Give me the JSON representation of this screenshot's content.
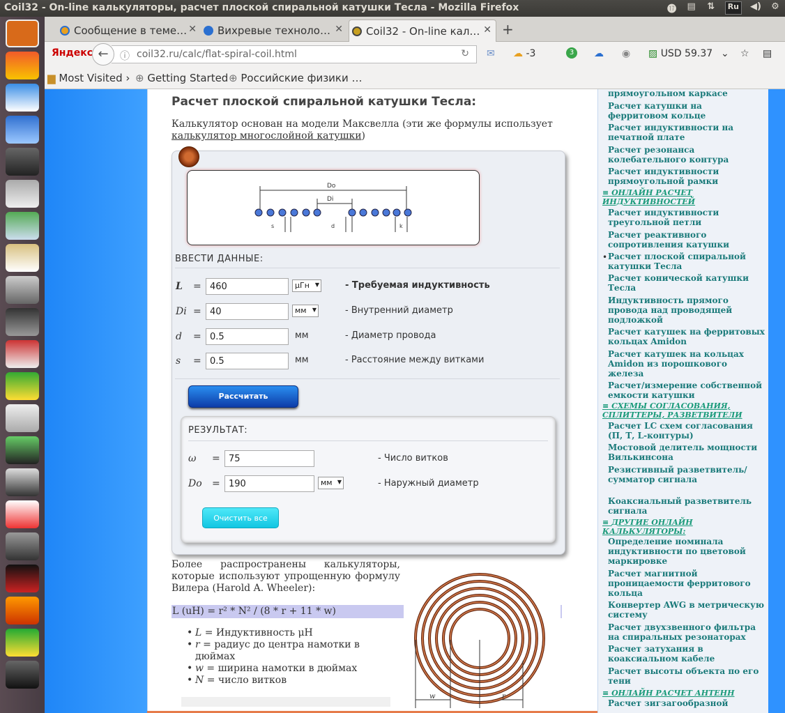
{
  "window": {
    "title": "Coil32 - On-line калькуляторы, расчет плоской спиральной катушки Тесла - Mozilla Firefox",
    "tray": {
      "keyboard": "Ru"
    }
  },
  "tabs": [
    {
      "label": "Сообщение в теме…",
      "active": false
    },
    {
      "label": "Вихревые техноло…",
      "active": false
    },
    {
      "label": "Coil32 - On-line кал…",
      "active": true
    }
  ],
  "navbar": {
    "yandex": "Яндекс",
    "url": "coil32.ru/calc/flat-spiral-coil.html",
    "weather": "-3",
    "badge": "3",
    "currency": "USD 59.37"
  },
  "bookmarks": [
    "Most Visited",
    "Getting Started",
    "Российские физики …"
  ],
  "page": {
    "title": "Расчет плоской спиральной катушки Тесла:",
    "intro_text": "Калькулятор основан на модели Максвелла (эти же формулы использует ",
    "intro_link": "калькулятор многослойной катушки",
    "intro_end": ")",
    "diagram_labels": {
      "do": "Do",
      "di": "Di",
      "s": "s",
      "d": "d",
      "k": "k"
    },
    "input_section": "ВВЕСТИ ДАННЫЕ:",
    "inputs": [
      {
        "symbol": "L",
        "value": "460",
        "unit": "μГн",
        "unit_is_select": true,
        "description": "- Требуемая индуктивность",
        "bold": true
      },
      {
        "symbol": "Di",
        "value": "40",
        "unit": "мм",
        "unit_is_select": true,
        "description": "- Внутренний диаметр",
        "bold": false
      },
      {
        "symbol": "d",
        "value": "0.5",
        "unit": "мм",
        "unit_is_select": false,
        "description": "- Диаметр провода",
        "bold": false
      },
      {
        "symbol": "s",
        "value": "0.5",
        "unit": "мм",
        "unit_is_select": false,
        "description": "- Расстояние между витками",
        "bold": false
      }
    ],
    "calc_button": "Рассчитать",
    "result_section": "РЕЗУЛЬТАТ:",
    "results": [
      {
        "symbol": "ω",
        "value": "75",
        "unit": "",
        "description": "- Число витков"
      },
      {
        "symbol": "Do",
        "value": "190",
        "unit": "мм",
        "description": "- Наружный диаметр"
      }
    ],
    "clear_button": "Очистить все",
    "wheeler_text": "Более распространены калькуляторы, которые используют упрощенную формулу Вилера (Harold A. Wheeler):",
    "formula": "L (uH) = r² * N² / (8 * r + 11 * w)",
    "bullets": [
      {
        "sym": "L",
        "text": " = Индуктивность μН"
      },
      {
        "sym": "r",
        "text": " = радиус до центра намотки в дюймах"
      },
      {
        "sym": "w",
        "text": " = ширина намотки в дюймах"
      },
      {
        "sym": "N",
        "text": " = число витков"
      }
    ],
    "spiral_labels": {
      "w": "w",
      "r": "r"
    }
  },
  "sidebar": {
    "links": [
      "прямоугольном каркасе",
      "Расчет катушки на ферритовом кольце",
      "Расчет индуктивности на печатной плате",
      "Расчет резонанса колебательного контура",
      "Расчет индуктивности прямоугольной рамки"
    ],
    "head1": "ОНЛАЙН РАСЧЕТ ИНДУКТИВНОСТЕЙ",
    "links2": [
      "Расчет индуктивности треугольной петли",
      "Расчет реактивного сопротивления катушки",
      "Расчет плоской спиральной катушки Тесла",
      "Расчет конической катушки Тесла",
      "Индуктивность прямого провода над проводящей подложкой",
      "Расчет катушек на ферритовых кольцах Amidon",
      "Расчет катушек на кольцах Amidon из порошкового железа",
      "Расчет/измерение собственной емкости катушки"
    ],
    "head2": "СХЕМЫ СОГЛАСОВАНИЯ, СПЛИТТЕРЫ, РАЗВЕТВИТЕЛИ",
    "links3": [
      "Расчет LC схем согласования (П, Т, L-контуры)",
      "Мостовой делитель мощности Вилькинсона",
      "Резистивный разветвитель/сумматор сигнала",
      "Коаксиальный разветвитель сигнала"
    ],
    "head3": "ДРУГИЕ ОНЛАЙН КАЛЬКУЛЯТОРЫ:",
    "links4": [
      "Определение номинала индуктивности по цветовой маркировке",
      "Расчет магнитной проницаемости ферритового кольца",
      "Конвертер AWG в метрическую систему",
      "Расчет двухзвенного фильтра на спиральных резонаторах",
      "Расчет затухания в коаксиальном кабеле",
      "Расчет высоты объекта по его тени"
    ],
    "head4": "ОНЛАЙН РАСЧЕТ АНТЕНН",
    "links5": [
      "Расчет зигзагообразной"
    ]
  },
  "colors": {
    "accent_blue": "#2f92ff",
    "sidebar_link": "#1a7a7a",
    "calc_button": "#0d3ca8",
    "clear_button": "#12c6e2"
  }
}
